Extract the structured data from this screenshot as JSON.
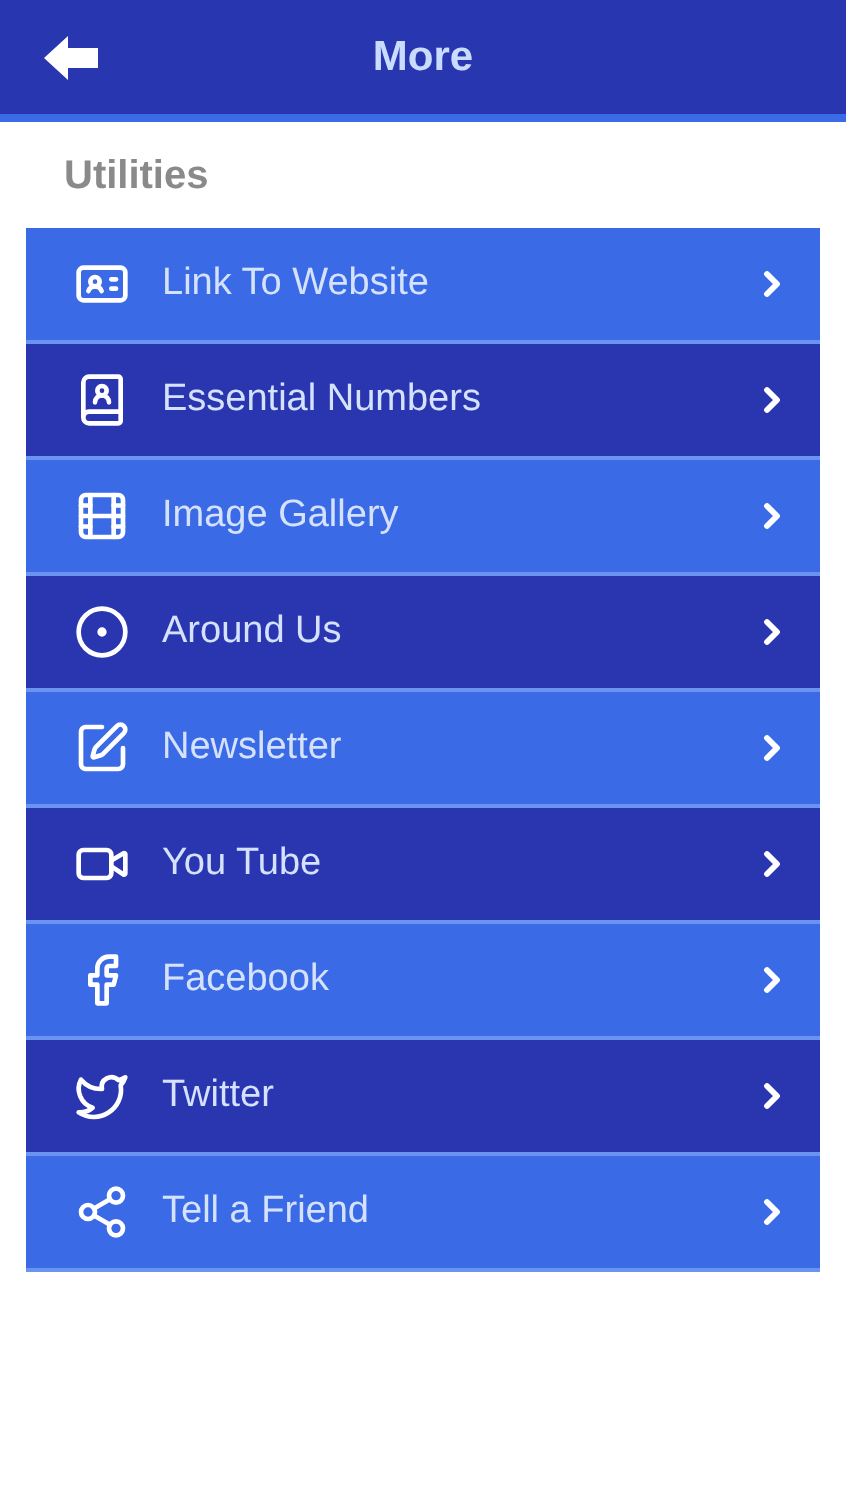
{
  "header": {
    "title": "More"
  },
  "section": {
    "title": "Utilities"
  },
  "items": [
    {
      "label": "Link To Website"
    },
    {
      "label": "Essential Numbers"
    },
    {
      "label": "Image Gallery"
    },
    {
      "label": "Around Us"
    },
    {
      "label": "Newsletter"
    },
    {
      "label": "You Tube"
    },
    {
      "label": "Facebook"
    },
    {
      "label": "Twitter"
    },
    {
      "label": "Tell a Friend"
    }
  ]
}
